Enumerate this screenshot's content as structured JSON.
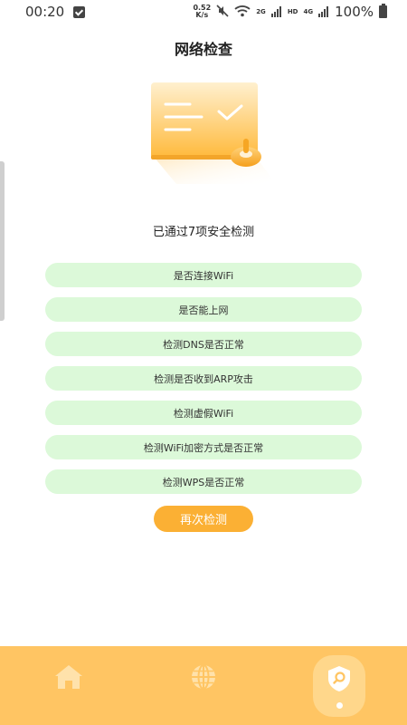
{
  "status_bar": {
    "time": "00:20",
    "speed_value": "0.52",
    "speed_unit": "K/s",
    "hd_label": "HD",
    "net_2g": "2G",
    "net_4g": "4G",
    "battery": "100%"
  },
  "header": {
    "title": "网络检查"
  },
  "summary": {
    "text": "已通过7项安全检测"
  },
  "checks": [
    {
      "label": "是否连接WiFi"
    },
    {
      "label": "是否能上网"
    },
    {
      "label": "检测DNS是否正常"
    },
    {
      "label": "检测是否收到ARP攻击"
    },
    {
      "label": "检测虚假WiFi"
    },
    {
      "label": "检测WiFi加密方式是否正常"
    },
    {
      "label": "检测WPS是否正常"
    }
  ],
  "actions": {
    "recheck_label": "再次检测"
  },
  "bottom_nav": {
    "items": [
      {
        "icon": "home-icon"
      },
      {
        "icon": "globe-icon"
      },
      {
        "icon": "shield-search-icon",
        "active": true
      }
    ]
  },
  "colors": {
    "accent": "#fbb034",
    "nav_background": "#ffc563",
    "check_item_background": "#dcf9d9"
  }
}
